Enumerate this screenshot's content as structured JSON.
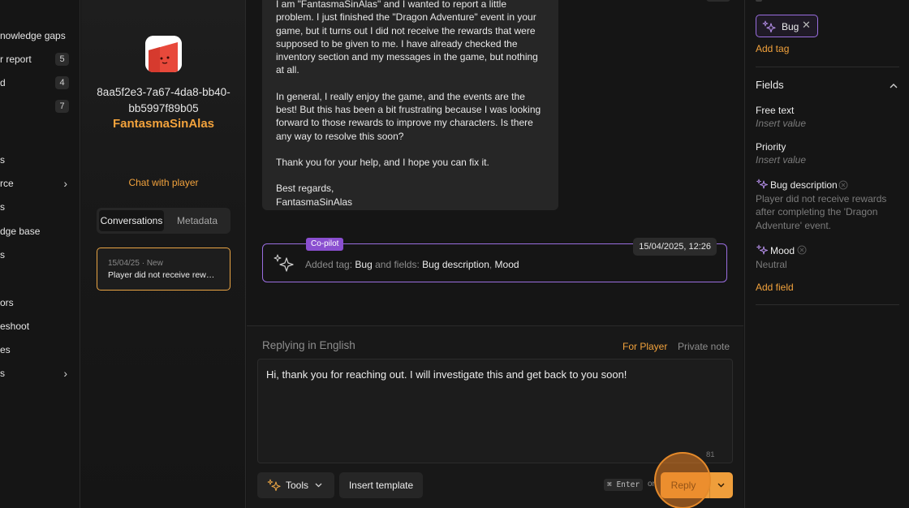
{
  "sidebar": {
    "items": [
      {
        "label": "nowledge gaps",
        "badge": null,
        "chevron": false
      },
      {
        "label": "r report",
        "badge": "5",
        "chevron": false
      },
      {
        "label": "d",
        "badge": "4",
        "chevron": false
      },
      {
        "label": "",
        "badge": "7",
        "chevron": false
      },
      {
        "label": "s",
        "badge": null,
        "chevron": false
      },
      {
        "label": "rce",
        "badge": null,
        "chevron": true
      },
      {
        "label": "s",
        "badge": null,
        "chevron": false
      },
      {
        "label": "dge base",
        "badge": null,
        "chevron": false
      },
      {
        "label": "s",
        "badge": null,
        "chevron": false
      },
      {
        "label": "ors",
        "badge": null,
        "chevron": false
      },
      {
        "label": "eshoot",
        "badge": null,
        "chevron": false
      },
      {
        "label": "es",
        "badge": null,
        "chevron": false
      },
      {
        "label": "s",
        "badge": null,
        "chevron": true
      }
    ]
  },
  "profile": {
    "user_id": "8aa5f2e3-7a67-4da8-bb40-bb5997f89b05",
    "user_name": "FantasmaSinAlas",
    "chat_with_player": "Chat with player",
    "tabs": [
      {
        "label": "Conversations",
        "active": true
      },
      {
        "label": "Metadata",
        "active": false
      }
    ],
    "conversation": {
      "meta": "15/04/25 · New",
      "title": "Player did not receive rewards after completing the event"
    }
  },
  "message": {
    "paragraphs": [
      "I am \"FantasmaSinAlas\" and I wanted to report a little problem. I just finished the \"Dragon Adventure\" event in your game, but it turns out I did not receive the rewards that were supposed to be given to me. I have already checked the inventory section and my messages in the game, but nothing at all.",
      "In general, I really enjoy the game, and the events are the best! But this has been a bit frustrating because I was looking forward to those rewards to improve my characters. Is there any way to resolve this soon?",
      "Thank you for your help, and I hope you can fix it.",
      "Best regards,\nFantasmaSinAlas"
    ]
  },
  "copilot": {
    "badge": "Co-pilot",
    "date": "15/04/2025, 12:26",
    "text_added_tag": "Added tag:",
    "tag": "Bug",
    "text_and_fields": "and fields:",
    "field_1": "Bug description",
    "field_2": "Mood"
  },
  "composer": {
    "replying_in": "Replying in English",
    "for_player": "For Player",
    "private_note": "Private note",
    "reply_text": "Hi, thank you for reaching out. I will investigate this and get back to you soon!",
    "char_count": "81",
    "tools_label": "Tools",
    "insert_template_label": "Insert template",
    "kbd_hint": "⌘ Enter",
    "kbd_or": "or",
    "reply_label": "Reply"
  },
  "right_panel": {
    "tag_chip": "Bug",
    "add_tag": "Add tag",
    "fields_title": "Fields",
    "fields": [
      {
        "label": "Free text",
        "value": "Insert value",
        "ai": false
      },
      {
        "label": "Priority",
        "value": "Insert value",
        "ai": false
      },
      {
        "label": "Bug description",
        "value": "Player did not receive rewards after completing the 'Dragon Adventure' event.",
        "ai": true
      },
      {
        "label": "Mood",
        "value": "Neutral",
        "ai": true
      }
    ],
    "add_field": "Add field"
  },
  "colors": {
    "accent_orange": "#f2a23c",
    "copilot_purple": "#9a6ee0",
    "background": "#151515"
  }
}
